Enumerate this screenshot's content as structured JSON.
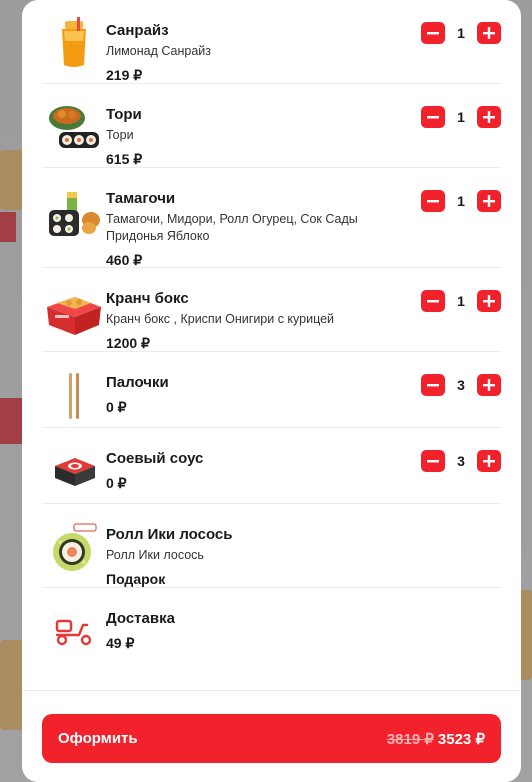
{
  "cart": {
    "items": [
      {
        "name": "Санрайз",
        "description": "Лимонад Санрайз",
        "price": "219 ₽",
        "quantity": "1",
        "image": "lemonade-drink"
      },
      {
        "name": "Тори",
        "description": "Тори",
        "price": "615 ₽",
        "quantity": "1",
        "image": "chicken-rolls-set"
      },
      {
        "name": "Тамагочи",
        "description": "Тамагочи, Мидори, Ролл Огурец, Сок Сады Придонья Яблоко",
        "price": "460 ₽",
        "quantity": "1",
        "image": "kids-set"
      },
      {
        "name": "Кранч бокс",
        "description": "Кранч бокс , Криспи Онигири с курицей",
        "price": "1200 ₽",
        "quantity": "1",
        "image": "crunch-box"
      },
      {
        "name": "Палочки",
        "description": "",
        "price": "0 ₽",
        "quantity": "3",
        "image": "chopsticks"
      },
      {
        "name": "Соевый соус",
        "description": "",
        "price": "0 ₽",
        "quantity": "3",
        "image": "soy-sauce"
      },
      {
        "name": "Ролл Ики лосось",
        "description": "Ролл Ики лосось",
        "price": "Подарок",
        "quantity": "",
        "image": "salmon-roll"
      },
      {
        "name": "Доставка",
        "description": "",
        "price": "49 ₽",
        "quantity": "",
        "image": "delivery-scooter-icon"
      }
    ]
  },
  "checkout": {
    "label": "Оформить",
    "old_price": "3819 ₽",
    "new_price": "3523 ₽"
  },
  "colors": {
    "accent": "#f2222d"
  }
}
